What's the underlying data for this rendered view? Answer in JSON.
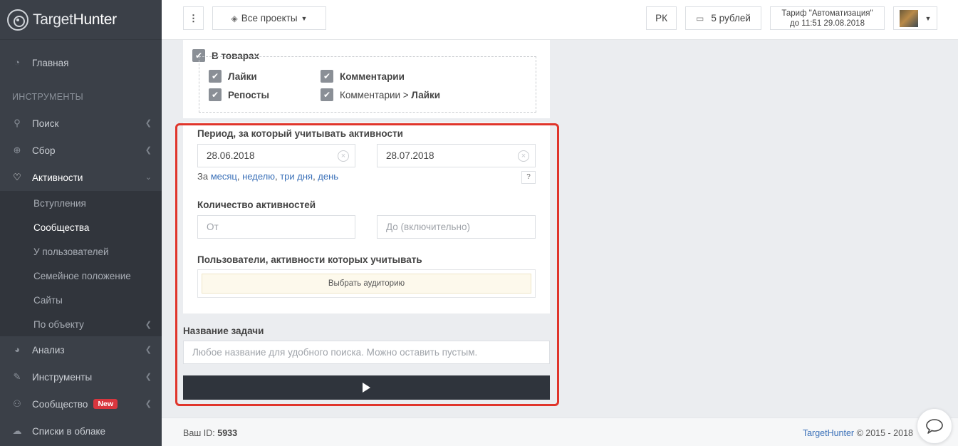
{
  "app": {
    "name_prefix": "Target",
    "name_suffix": "Hunter"
  },
  "sidebar": {
    "home": "Главная",
    "section_tools": "ИНСТРУМЕНТЫ",
    "search": "Поиск",
    "collect": "Сбор",
    "activities": "Активности",
    "sub": [
      "Вступления",
      "Сообщества",
      "У пользователей",
      "Семейное положение",
      "Сайты",
      "По объекту"
    ],
    "analysis": "Анализ",
    "tools": "Инструменты",
    "community": "Сообщество",
    "community_badge": "New",
    "cloud_lists": "Списки в облаке"
  },
  "topbar": {
    "menu_icon": "⋮",
    "projects": "Все проекты",
    "lang": "РК",
    "balance": "5 рублей",
    "tariff_line1": "Тариф \"Автоматизация\"",
    "tariff_line2": "до 11:51 29.08.2018"
  },
  "goods": {
    "title": "В товарах",
    "likes": "Лайки",
    "comments": "Комментарии",
    "reposts": "Репосты",
    "comments_likes_prefix": "Комментарии > ",
    "comments_likes_bold": "Лайки"
  },
  "period": {
    "label": "Период, за который учитывать активности",
    "from": "28.06.2018",
    "to": "28.07.2018",
    "quick_prefix": "За",
    "quick_links": [
      "месяц",
      "неделю",
      "три дня",
      "день"
    ],
    "help": "?"
  },
  "count": {
    "label": "Количество активностей",
    "from_placeholder": "От",
    "to_placeholder": "До (включительно)"
  },
  "users": {
    "label": "Пользователи, активности которых учитывать",
    "select_button": "Выбрать аудиторию"
  },
  "task": {
    "label": "Название задачи",
    "placeholder": "Любое название для удобного поиска. Можно оставить пустым."
  },
  "footer": {
    "id_label": "Ваш ID:",
    "id_value": "5933",
    "brand": "TargetHunter",
    "copyright": "© 2015 - 2018"
  },
  "colors": {
    "highlight": "#e0352b",
    "run_button": "#2f343c",
    "link": "#3a70b8"
  }
}
